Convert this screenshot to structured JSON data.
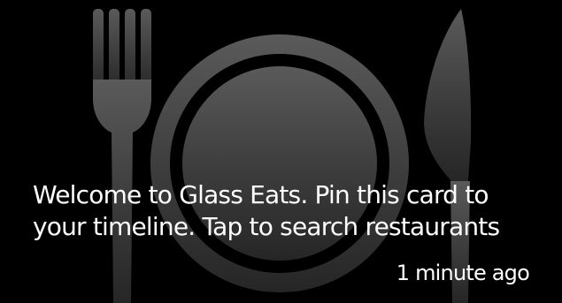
{
  "card": {
    "message": "Welcome to Glass Eats. Pin this card to your timeline. Tap to search restaurants",
    "timestamp": "1 minute ago",
    "background_icons": [
      "fork-icon",
      "plate-icon",
      "knife-icon"
    ]
  },
  "colors": {
    "background": "#000000",
    "text": "#ffffff",
    "icon_light": "#555555",
    "icon_dark": "#2b2b2b"
  }
}
